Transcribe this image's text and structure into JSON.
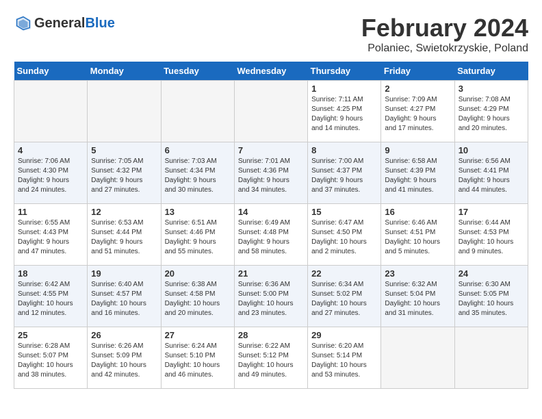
{
  "header": {
    "logo_general": "General",
    "logo_blue": "Blue",
    "month_year": "February 2024",
    "location": "Polaniec, Swietokrzyskie, Poland"
  },
  "weekdays": [
    "Sunday",
    "Monday",
    "Tuesday",
    "Wednesday",
    "Thursday",
    "Friday",
    "Saturday"
  ],
  "weeks": [
    [
      {
        "day": "",
        "info": ""
      },
      {
        "day": "",
        "info": ""
      },
      {
        "day": "",
        "info": ""
      },
      {
        "day": "",
        "info": ""
      },
      {
        "day": "1",
        "info": "Sunrise: 7:11 AM\nSunset: 4:25 PM\nDaylight: 9 hours\nand 14 minutes."
      },
      {
        "day": "2",
        "info": "Sunrise: 7:09 AM\nSunset: 4:27 PM\nDaylight: 9 hours\nand 17 minutes."
      },
      {
        "day": "3",
        "info": "Sunrise: 7:08 AM\nSunset: 4:29 PM\nDaylight: 9 hours\nand 20 minutes."
      }
    ],
    [
      {
        "day": "4",
        "info": "Sunrise: 7:06 AM\nSunset: 4:30 PM\nDaylight: 9 hours\nand 24 minutes."
      },
      {
        "day": "5",
        "info": "Sunrise: 7:05 AM\nSunset: 4:32 PM\nDaylight: 9 hours\nand 27 minutes."
      },
      {
        "day": "6",
        "info": "Sunrise: 7:03 AM\nSunset: 4:34 PM\nDaylight: 9 hours\nand 30 minutes."
      },
      {
        "day": "7",
        "info": "Sunrise: 7:01 AM\nSunset: 4:36 PM\nDaylight: 9 hours\nand 34 minutes."
      },
      {
        "day": "8",
        "info": "Sunrise: 7:00 AM\nSunset: 4:37 PM\nDaylight: 9 hours\nand 37 minutes."
      },
      {
        "day": "9",
        "info": "Sunrise: 6:58 AM\nSunset: 4:39 PM\nDaylight: 9 hours\nand 41 minutes."
      },
      {
        "day": "10",
        "info": "Sunrise: 6:56 AM\nSunset: 4:41 PM\nDaylight: 9 hours\nand 44 minutes."
      }
    ],
    [
      {
        "day": "11",
        "info": "Sunrise: 6:55 AM\nSunset: 4:43 PM\nDaylight: 9 hours\nand 47 minutes."
      },
      {
        "day": "12",
        "info": "Sunrise: 6:53 AM\nSunset: 4:44 PM\nDaylight: 9 hours\nand 51 minutes."
      },
      {
        "day": "13",
        "info": "Sunrise: 6:51 AM\nSunset: 4:46 PM\nDaylight: 9 hours\nand 55 minutes."
      },
      {
        "day": "14",
        "info": "Sunrise: 6:49 AM\nSunset: 4:48 PM\nDaylight: 9 hours\nand 58 minutes."
      },
      {
        "day": "15",
        "info": "Sunrise: 6:47 AM\nSunset: 4:50 PM\nDaylight: 10 hours\nand 2 minutes."
      },
      {
        "day": "16",
        "info": "Sunrise: 6:46 AM\nSunset: 4:51 PM\nDaylight: 10 hours\nand 5 minutes."
      },
      {
        "day": "17",
        "info": "Sunrise: 6:44 AM\nSunset: 4:53 PM\nDaylight: 10 hours\nand 9 minutes."
      }
    ],
    [
      {
        "day": "18",
        "info": "Sunrise: 6:42 AM\nSunset: 4:55 PM\nDaylight: 10 hours\nand 12 minutes."
      },
      {
        "day": "19",
        "info": "Sunrise: 6:40 AM\nSunset: 4:57 PM\nDaylight: 10 hours\nand 16 minutes."
      },
      {
        "day": "20",
        "info": "Sunrise: 6:38 AM\nSunset: 4:58 PM\nDaylight: 10 hours\nand 20 minutes."
      },
      {
        "day": "21",
        "info": "Sunrise: 6:36 AM\nSunset: 5:00 PM\nDaylight: 10 hours\nand 23 minutes."
      },
      {
        "day": "22",
        "info": "Sunrise: 6:34 AM\nSunset: 5:02 PM\nDaylight: 10 hours\nand 27 minutes."
      },
      {
        "day": "23",
        "info": "Sunrise: 6:32 AM\nSunset: 5:04 PM\nDaylight: 10 hours\nand 31 minutes."
      },
      {
        "day": "24",
        "info": "Sunrise: 6:30 AM\nSunset: 5:05 PM\nDaylight: 10 hours\nand 35 minutes."
      }
    ],
    [
      {
        "day": "25",
        "info": "Sunrise: 6:28 AM\nSunset: 5:07 PM\nDaylight: 10 hours\nand 38 minutes."
      },
      {
        "day": "26",
        "info": "Sunrise: 6:26 AM\nSunset: 5:09 PM\nDaylight: 10 hours\nand 42 minutes."
      },
      {
        "day": "27",
        "info": "Sunrise: 6:24 AM\nSunset: 5:10 PM\nDaylight: 10 hours\nand 46 minutes."
      },
      {
        "day": "28",
        "info": "Sunrise: 6:22 AM\nSunset: 5:12 PM\nDaylight: 10 hours\nand 49 minutes."
      },
      {
        "day": "29",
        "info": "Sunrise: 6:20 AM\nSunset: 5:14 PM\nDaylight: 10 hours\nand 53 minutes."
      },
      {
        "day": "",
        "info": ""
      },
      {
        "day": "",
        "info": ""
      }
    ]
  ]
}
